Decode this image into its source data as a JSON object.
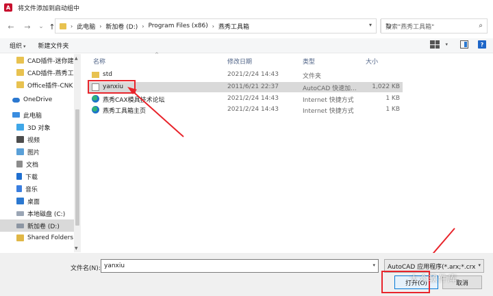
{
  "window": {
    "app_icon": "A",
    "title": "将文件添加到启动组中"
  },
  "nav": {
    "back_icon": "←",
    "forward_icon": "→",
    "recent_icon": "⌄",
    "up_icon": "↑",
    "breadcrumb": [
      "此电脑",
      "新加卷 (D:)",
      "Program Files (x86)",
      "燕秀工具箱"
    ],
    "refresh_icon": "↻",
    "search_placeholder": "搜索\"燕秀工具箱\"",
    "search_icon": "⌕"
  },
  "toolbar": {
    "organize": "组织",
    "new_folder": "新建文件夹"
  },
  "sidebar": {
    "items": [
      {
        "label": "CAD插件-迷你建",
        "icon": "folder"
      },
      {
        "label": "CAD插件-燕秀工",
        "icon": "folder"
      },
      {
        "label": "Office插件-CNK",
        "icon": "folder"
      },
      {
        "label": "OneDrive",
        "icon": "cloud"
      },
      {
        "label": "此电脑",
        "icon": "pc"
      },
      {
        "label": "3D 对象",
        "icon": "3d"
      },
      {
        "label": "视频",
        "icon": "video"
      },
      {
        "label": "图片",
        "icon": "img"
      },
      {
        "label": "文档",
        "icon": "doc"
      },
      {
        "label": "下载",
        "icon": "dl"
      },
      {
        "label": "音乐",
        "icon": "music"
      },
      {
        "label": "桌面",
        "icon": "desk"
      },
      {
        "label": "本地磁盘 (C:)",
        "icon": "drive"
      },
      {
        "label": "新加卷 (D:)",
        "icon": "drive2"
      },
      {
        "label": "Shared Folders",
        "icon": "shared"
      }
    ]
  },
  "columns": {
    "name": "名称",
    "modified": "修改日期",
    "type": "类型",
    "size": "大小"
  },
  "files": [
    {
      "name": "std",
      "modified": "2021/2/24 14:43",
      "type": "文件夹",
      "size": "",
      "icon": "folder"
    },
    {
      "name": "yanxiu",
      "modified": "2011/6/21 22:37",
      "type": "AutoCAD 快速加...",
      "size": "1,022 KB",
      "icon": "file"
    },
    {
      "name": "燕秀CAX模具技术论坛",
      "modified": "2021/2/24 14:43",
      "type": "Internet 快捷方式",
      "size": "1 KB",
      "icon": "web"
    },
    {
      "name": "燕秀工具箱主页",
      "modified": "2021/2/24 14:43",
      "type": "Internet 快捷方式",
      "size": "1 KB",
      "icon": "web"
    }
  ],
  "bottom": {
    "filename_label": "文件名(N):",
    "filename_value": "yanxiu",
    "filter_value": "AutoCAD 应用程序(*.arx;*.crx",
    "open_button": "打开(O)",
    "cancel_button": "取消",
    "watermark": "大众软件库"
  },
  "colors": {
    "accent": "#0078d7",
    "annotation": "#e8242b",
    "selection": "#d9d9d9"
  }
}
